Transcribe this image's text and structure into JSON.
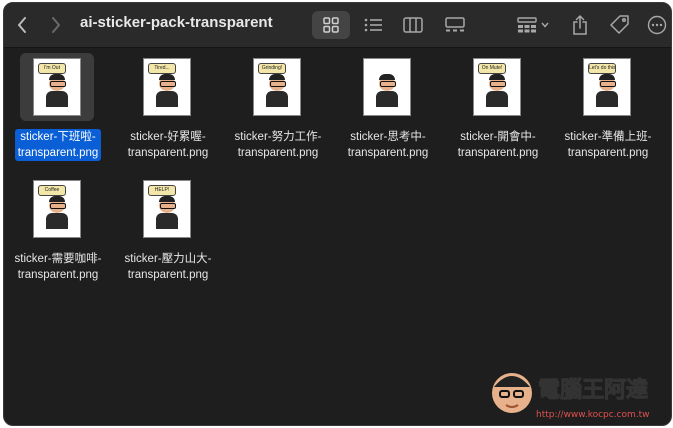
{
  "window": {
    "title": "ai-sticker-pack-transparent"
  },
  "toolbar": {
    "back_icon": "chevron-left-icon",
    "forward_icon": "chevron-right-icon",
    "views": [
      "icon-view",
      "list-view",
      "column-view",
      "gallery-view"
    ],
    "active_view": "icon-view",
    "group_icon": "group-by-icon",
    "share_icon": "share-icon",
    "tag_icon": "tag-icon",
    "more_icon": "ellipsis-icon"
  },
  "files": [
    {
      "line1": "sticker-下班啦-",
      "line2": "transparent.png",
      "bubble": "I'm Out",
      "selected": true
    },
    {
      "line1": "sticker-好累喔-",
      "line2": "transparent.png",
      "bubble": "Tired...",
      "selected": false
    },
    {
      "line1": "sticker-努力工作-",
      "line2": "transparent.png",
      "bubble": "Grinding!",
      "selected": false
    },
    {
      "line1": "sticker-思考中-",
      "line2": "transparent.png",
      "bubble": "",
      "selected": false
    },
    {
      "line1": "sticker-開會中-",
      "line2": "transparent.png",
      "bubble": "On Mute!",
      "selected": false
    },
    {
      "line1": "sticker-準備上班-",
      "line2": "transparent.png",
      "bubble": "Let's do this",
      "selected": false
    },
    {
      "line1": "sticker-需要咖啡-",
      "line2": "transparent.png",
      "bubble": "Coffee",
      "selected": false
    },
    {
      "line1": "sticker-壓力山大-",
      "line2": "transparent.png",
      "bubble": "HELP!",
      "selected": false
    }
  ],
  "watermark": {
    "title": "電腦王阿達",
    "url": "http://www.kocpc.com.tw"
  },
  "colors": {
    "selection": "#0a5fd6",
    "background": "#1e1e1e",
    "toolbar": "#2a2a2a"
  }
}
